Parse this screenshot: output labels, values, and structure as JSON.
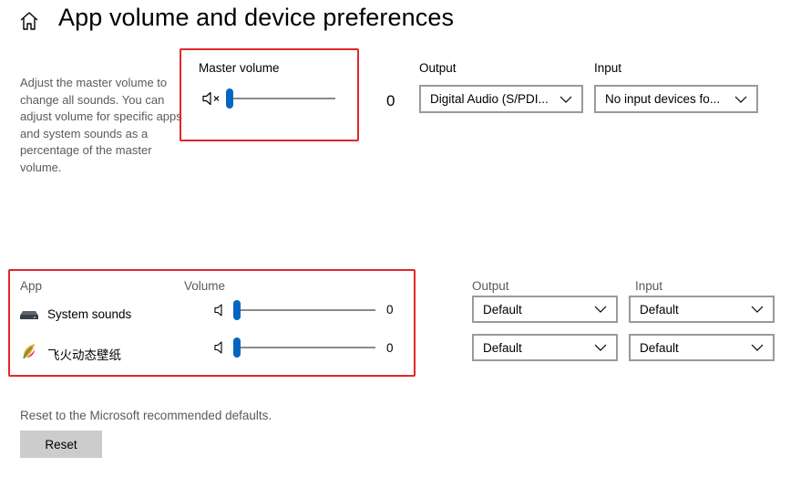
{
  "header": {
    "title": "App volume and device preferences"
  },
  "description": "Adjust the master volume to change all sounds. You can adjust volume for specific apps and system sounds as a percentage of the master volume.",
  "master": {
    "label": "Master volume",
    "volume": "0",
    "icon": "speaker-muted-icon"
  },
  "device": {
    "output_label": "Output",
    "input_label": "Input",
    "output_value": "Digital Audio (S/PDI...",
    "input_value": "No input devices fo..."
  },
  "apps": {
    "app_header": "App",
    "volume_header": "Volume",
    "output_header": "Output",
    "input_header": "Input",
    "rows": [
      {
        "name": "System sounds",
        "volume": "0",
        "output": "Default",
        "input": "Default",
        "icon": "system-sounds-icon"
      },
      {
        "name": "飞火动态壁纸",
        "volume": "0",
        "output": "Default",
        "input": "Default",
        "icon": "feihuo-wallpaper-icon"
      }
    ]
  },
  "reset": {
    "text": "Reset to the Microsoft recommended defaults.",
    "button": "Reset"
  },
  "colors": {
    "accent": "#0067c0",
    "highlight_border": "#e3262c"
  }
}
